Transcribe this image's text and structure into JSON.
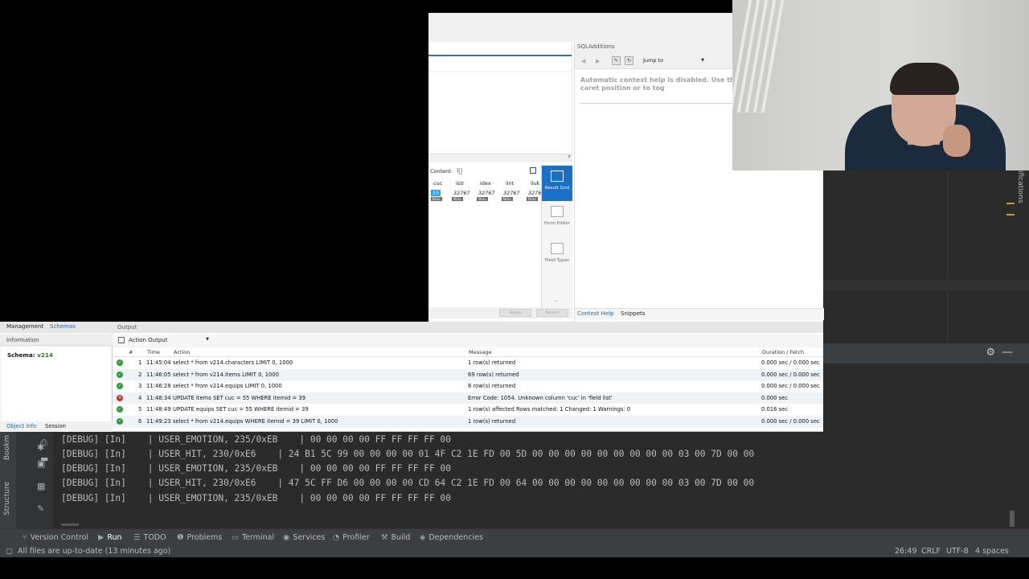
{
  "ide": {
    "tool_window_label": "ifications",
    "left_strip": [
      "Bookm",
      "Structure"
    ],
    "console_lines": [
      "[DEBUG] [In]    | USER_EMOTION, 235/0xEB    | 00 00 00 00 FF FF FF FF 00",
      "[DEBUG] [In]    | USER_HIT, 230/0xE6    | 24 B1 5C 99 00 00 00 00 01 4F C2 1E FD 00 5D 00 00 00 00 00 00 00 00 00 03 00 7D 00 00",
      "[DEBUG] [In]    | USER_EMOTION, 235/0xEB    | 00 00 00 00 FF FF FF FF 00",
      "[DEBUG] [In]    | USER_HIT, 230/0xE6    | 47 5C FF D6 00 00 00 00 CD 64 C2 1E FD 00 64 00 00 00 00 00 00 00 00 00 03 00 7D 00 00",
      "[DEBUG] [In]    | USER_EMOTION, 235/0xEB    | 00 00 00 00 FF FF FF FF 00"
    ],
    "toolbar": [
      {
        "icon": "⑂",
        "label": "Version Control"
      },
      {
        "icon": "▶",
        "label": "Run"
      },
      {
        "icon": "☰",
        "label": "TODO"
      },
      {
        "icon": "❶",
        "label": "Problems"
      },
      {
        "icon": "▭",
        "label": "Terminal"
      },
      {
        "icon": "◉",
        "label": "Services"
      },
      {
        "icon": "◔",
        "label": "Profiler"
      },
      {
        "icon": "⚒",
        "label": "Build"
      },
      {
        "icon": "◈",
        "label": "Dependencies"
      }
    ],
    "status_left": "All files are up-to-date (13 minutes ago)",
    "status_right": {
      "position": "26:49",
      "line_sep": "CRLF",
      "encoding": "UTF-8",
      "indent": "4 spaces"
    }
  },
  "workbench": {
    "result": {
      "content_label": "Content:",
      "columns": [
        "cuc",
        "istr",
        "idex",
        "iint",
        "iluk"
      ],
      "row": [
        "55",
        "32767",
        "32767",
        "32767",
        "3276"
      ],
      "null_label": "NULL",
      "apply": "Apply",
      "revert": "Revert"
    },
    "side_panel": [
      {
        "label": "Result Grid"
      },
      {
        "label": "Form Editor"
      },
      {
        "label": "Field Types"
      }
    ],
    "sql_additions": {
      "title": "SQLAdditions",
      "jump_to": "Jump to",
      "help": "Automatic context help is disabled. Use the help for the current caret position or to tog",
      "tabs": [
        "Context Help",
        "Snippets"
      ]
    },
    "left_panel": {
      "tabs": [
        "Management",
        "Schemas"
      ],
      "info_header": "Information",
      "schema_label": "Schema:",
      "schema_value": "v214",
      "foot_tabs": [
        "Object Info",
        "Session"
      ]
    },
    "output": {
      "header": "Output",
      "selector": "Action Output",
      "columns": [
        "#",
        "Time",
        "Action",
        "Message",
        "Duration / Fetch"
      ],
      "rows": [
        {
          "status": "ok",
          "n": "1",
          "time": "11:45:04",
          "action": "select * from v214.characters LIMIT 0, 1000",
          "message": "1 row(s) returned",
          "duration": "0.000 sec / 0.000 sec"
        },
        {
          "status": "ok",
          "n": "2",
          "time": "11:46:05",
          "action": "select * from v214.items LIMIT 0, 1000",
          "message": "69 row(s) returned",
          "duration": "0.000 sec / 0.000 sec"
        },
        {
          "status": "ok",
          "n": "3",
          "time": "11:46:28",
          "action": "select * from v214.equips LIMIT 0, 1000",
          "message": "8 row(s) returned",
          "duration": "0.000 sec / 0.000 sec"
        },
        {
          "status": "err",
          "n": "4",
          "time": "11:48:34",
          "action": "UPDATE items SET cuc = 55 WHERE itemid = 39",
          "message": "Error Code: 1054. Unknown column 'cuc' in 'field list'",
          "duration": "0.000 sec"
        },
        {
          "status": "ok",
          "n": "5",
          "time": "11:48:49",
          "action": "UPDATE equips SET cuc = 55 WHERE itemid = 39",
          "message": "1 row(s) affected Rows matched: 1  Changed: 1  Warnings: 0",
          "duration": "0.016 sec"
        },
        {
          "status": "ok",
          "n": "6",
          "time": "11:49:23",
          "action": "select * from v214.equips WHERE itemid = 39 LIMIT 0, 1000",
          "message": "1 row(s) returned",
          "duration": "0.000 sec / 0.000 sec"
        }
      ]
    }
  },
  "colors": {
    "ide_bg": "#2b2b2b",
    "accent_blue": "#1a6fc9",
    "ok": "#2e9b36",
    "error": "#c73333"
  }
}
